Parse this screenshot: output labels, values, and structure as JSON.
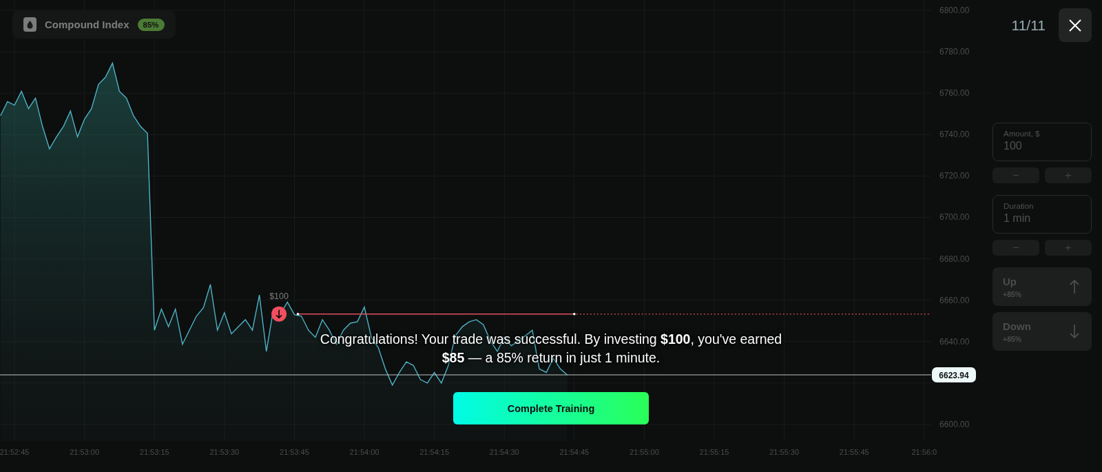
{
  "instrument": {
    "name": "Compound Index",
    "payout": "85%"
  },
  "step": {
    "counter": "11/11"
  },
  "chart": {
    "chart_data": {
      "type": "area",
      "categories": [
        null,
        null,
        "21:52:45",
        null,
        null,
        null,
        null,
        null,
        null,
        null,
        null,
        null,
        "21:53:00",
        null,
        null,
        null,
        null,
        null,
        null,
        null,
        null,
        null,
        "21:53:15",
        null,
        null,
        null,
        null,
        null,
        null,
        null,
        null,
        null,
        "21:53:30",
        null,
        null,
        null,
        null,
        null,
        null,
        null,
        null,
        null,
        "21:53:45",
        null,
        null,
        null,
        null,
        null,
        null,
        null,
        null,
        null,
        "21:54:00",
        null,
        null,
        null,
        null,
        null,
        null,
        null,
        null,
        null,
        "21:54:15",
        null,
        null,
        null,
        null,
        null,
        null,
        null,
        null,
        null,
        "21:54:30",
        null,
        null,
        null,
        null,
        null,
        null,
        null,
        null,
        null,
        "21:54:45",
        null,
        null,
        null,
        null,
        null,
        null,
        null,
        null,
        null,
        "21:55:00",
        null,
        null,
        null,
        null,
        null,
        null,
        null,
        null,
        null,
        "21:55:15",
        null,
        null,
        null,
        null,
        null,
        null,
        null,
        null,
        null,
        "21:55:30",
        null,
        null,
        null,
        null,
        null,
        null,
        null,
        null,
        null,
        "21:55:45",
        null,
        null,
        null,
        null,
        null,
        null,
        null,
        null,
        null,
        "21:56:0"
      ],
      "values": [
        6749.1,
        6755.9,
        6754.2,
        6760.9,
        6752.5,
        6757.6,
        6744.0,
        6733.1,
        6738.9,
        6744.0,
        6751.4,
        6738.9,
        6747.4,
        6752.5,
        6764.3,
        6767.7,
        6774.5,
        6760.9,
        6757.6,
        6749.1,
        6744.0,
        6740.6,
        6645.5,
        6655.7,
        6647.2,
        6655.7,
        6638.7,
        6645.5,
        6652.3,
        6656.4,
        6667.6,
        6645.5,
        6654.0,
        6643.8,
        6647.2,
        6650.6,
        6645.5,
        6662.5,
        6635.3,
        6655.7,
        6653.3,
        6659.1,
        6653.0,
        6652.3,
        6645.5,
        6642.1,
        6650.6,
        6645.5,
        6638.7,
        6645.5,
        6648.9,
        6649.6,
        6656.7,
        6642.1,
        6637.0,
        6626.8,
        6619.0,
        6625.1,
        6630.2,
        6628.5,
        6621.7,
        6620.0,
        6625.1,
        6620.0,
        6628.5,
        6642.8,
        6647.2,
        6649.6,
        6650.6,
        6648.2,
        6640.4,
        6635.3,
        6642.1,
        6638.0,
        6640.4,
        6642.8,
        6645.5,
        6626.8,
        6625.1,
        6631.9,
        6626.8,
        6623.9,
        null,
        null,
        null,
        null,
        null,
        null,
        null,
        null,
        null,
        null,
        null,
        null,
        null,
        null,
        null,
        null,
        null,
        null,
        null,
        null,
        null,
        null,
        null,
        null,
        null,
        null,
        null,
        null,
        null,
        null,
        null,
        null,
        null,
        null,
        null,
        null,
        null,
        null,
        null,
        null,
        null,
        null,
        null,
        null,
        null,
        null,
        null,
        null,
        null,
        null,
        null
      ],
      "ylim": [
        6592,
        6805
      ],
      "grid": true,
      "ref_lines": [
        {
          "axis": "y",
          "value": 6623.94,
          "label": "6623.94"
        }
      ],
      "yticks": [
        {
          "value": 6800,
          "label": "6800.00"
        },
        {
          "value": 6780,
          "label": "6780.00"
        },
        {
          "value": 6760,
          "label": "6760.00"
        },
        {
          "value": 6740,
          "label": "6740.00"
        },
        {
          "value": 6720,
          "label": "6720.00"
        },
        {
          "value": 6700,
          "label": "6700.00"
        },
        {
          "value": 6680,
          "label": "6680.00"
        },
        {
          "value": 6660,
          "label": "6660.00"
        },
        {
          "value": 6640,
          "label": "6640.00"
        },
        {
          "value": 6600,
          "label": "6600.00"
        }
      ]
    },
    "trade": {
      "amount": "$100"
    }
  },
  "message": "Congratulations! Your trade was successful. By investing **$100**, you've earned **$85** — a 85% return in just 1 minute.",
  "action": {
    "label": "Complete Training"
  },
  "panel": {
    "fields": [
      {
        "label": "Amount, $",
        "value": "100",
        "decrement": "−",
        "increment": "+"
      },
      {
        "label": "Duration",
        "value": "1 min",
        "decrement": "−",
        "increment": "+"
      }
    ],
    "directions": [
      {
        "kind": "up",
        "label": "Up",
        "payout": "+85%"
      },
      {
        "kind": "down",
        "label": "Down",
        "payout": "+85%"
      }
    ]
  }
}
